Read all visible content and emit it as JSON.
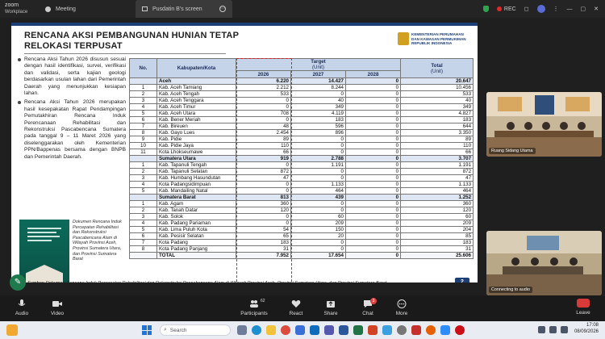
{
  "app": {
    "name_line1": "zoom",
    "name_line2": "Workplace",
    "meeting_tab": "Meeting",
    "share_tab": "Pusdatin B's screen",
    "rec_label": "REC"
  },
  "slide": {
    "title_line1": "RENCANA AKSI PEMBANGUNAN HUNIAN TETAP",
    "title_line2": "RELOKASI TERPUSAT",
    "ministry_name": "KEMENTERIAN PERUMAHAN DAN KAWASAN PERMUKIMAN REPUBLIK INDONESIA",
    "bullets": [
      "Rencana Aksi Tahun 2026 disusun sesuai dengan hasil identifikasi, survei, verifikasi dan validasi, serta kajian geologi berdasarkan usulan lahan dari Pemerintah Daerah yang menunjukkan kesiapan lahan.",
      "Rencana Aksi Tahun 2026 merupakan hasil kesepakatan Rapat Pendampingan Pemutakhiran Rencana Induk Perencanaan Rehabilitasi dan Rekonstruksi Pascabencana Sumatera pada tanggal 9 – 11 Maret 2026 yang diselenggarakan oleh Kementerian PPN/Bappenas bersama dengan BNPB dan Pemerintah Daerah."
    ],
    "doc_caption": "Dokumen Rencana Induk Percepatan Rehabilitasi dan Rekonstruksi Pascabencana Alam di Wilayah Provinsi Aceh, Provinsi Sumatera Utara, dan Provinsi Sumatera Barat",
    "source": "Sumber: Dokumen Rencana Induk Percepatan Rehabilitasi dan Rekonstruksi Pascabencana Alam di Wilayah Provinsi Aceh, Provinsi Sumatera Utara, dan Provinsi Sumatera Barat",
    "page": "2",
    "table": {
      "headers": {
        "no": "No.",
        "kab": "Kabupaten/Kota",
        "target": "Target",
        "target_unit": "(Unit)",
        "y2026": "2026",
        "y2027": "2027",
        "y2028": "2028",
        "total": "Total",
        "total_unit": "(Unit)"
      },
      "rows": [
        {
          "type": "group",
          "no": "",
          "name": "Aceh",
          "y2026": "6.220",
          "y2027": "14.427",
          "y2028": "0",
          "total": "20.647"
        },
        {
          "type": "row",
          "no": "1",
          "name": "Kab. Aceh Tamiang",
          "y2026": "2.212",
          "y2027": "8.244",
          "y2028": "0",
          "total": "10.456"
        },
        {
          "type": "row",
          "no": "2",
          "name": "Kab. Aceh Tengah",
          "y2026": "533",
          "y2027": "0",
          "y2028": "0",
          "total": "533"
        },
        {
          "type": "row",
          "no": "3",
          "name": "Kab. Aceh Tenggara",
          "y2026": "0",
          "y2027": "40",
          "y2028": "0",
          "total": "40"
        },
        {
          "type": "row",
          "no": "4",
          "name": "Kab. Aceh Timur",
          "y2026": "0",
          "y2027": "349",
          "y2028": "0",
          "total": "349"
        },
        {
          "type": "row",
          "no": "5",
          "name": "Kab. Aceh Utara",
          "y2026": "708",
          "y2027": "4.119",
          "y2028": "0",
          "total": "4.827"
        },
        {
          "type": "row",
          "no": "6",
          "name": "Kab. Bener Meriah",
          "y2026": "0",
          "y2027": "183",
          "y2028": "0",
          "total": "183"
        },
        {
          "type": "row",
          "no": "7",
          "name": "Kab. Bireuen",
          "y2026": "48",
          "y2027": "596",
          "y2028": "0",
          "total": "644"
        },
        {
          "type": "row",
          "no": "8",
          "name": "Kab. Gayo Lues",
          "y2026": "2.454",
          "y2027": "896",
          "y2028": "0",
          "total": "3.350"
        },
        {
          "type": "row",
          "no": "9",
          "name": "Kab. Pidie",
          "y2026": "89",
          "y2027": "0",
          "y2028": "0",
          "total": "89"
        },
        {
          "type": "row",
          "no": "10",
          "name": "Kab. Pidie Jaya",
          "y2026": "110",
          "y2027": "0",
          "y2028": "0",
          "total": "110"
        },
        {
          "type": "row",
          "no": "11",
          "name": "Kota Lhokseumawe",
          "y2026": "66",
          "y2027": "0",
          "y2028": "0",
          "total": "66"
        },
        {
          "type": "group",
          "no": "",
          "name": "Sumatera Utara",
          "y2026": "919",
          "y2027": "2.788",
          "y2028": "0",
          "total": "3.707"
        },
        {
          "type": "row",
          "no": "1",
          "name": "Kab. Tapanuli Tengah",
          "y2026": "0",
          "y2027": "1.191",
          "y2028": "0",
          "total": "1.191"
        },
        {
          "type": "row",
          "no": "2",
          "name": "Kab. Tapanuli Selatan",
          "y2026": "872",
          "y2027": "0",
          "y2028": "0",
          "total": "872"
        },
        {
          "type": "row",
          "no": "3",
          "name": "Kab. Humbang Hasundutan",
          "y2026": "47",
          "y2027": "0",
          "y2028": "0",
          "total": "47"
        },
        {
          "type": "row",
          "no": "4",
          "name": "Kota Padangsidimpuan",
          "y2026": "0",
          "y2027": "1.133",
          "y2028": "0",
          "total": "1.133"
        },
        {
          "type": "row",
          "no": "5",
          "name": "Kab. Mandailing Natal",
          "y2026": "0",
          "y2027": "464",
          "y2028": "0",
          "total": "464"
        },
        {
          "type": "group",
          "no": "",
          "name": "Sumatera Barat",
          "y2026": "813",
          "y2027": "439",
          "y2028": "0",
          "total": "1.252"
        },
        {
          "type": "row",
          "no": "1",
          "name": "Kab. Agam",
          "y2026": "360",
          "y2027": "0",
          "y2028": "0",
          "total": "360"
        },
        {
          "type": "row",
          "no": "2",
          "name": "Kab. Tanah Datar",
          "y2026": "120",
          "y2027": "0",
          "y2028": "0",
          "total": "120"
        },
        {
          "type": "row",
          "no": "3",
          "name": "Kab. Solok",
          "y2026": "0",
          "y2027": "60",
          "y2028": "0",
          "total": "60"
        },
        {
          "type": "row",
          "no": "4",
          "name": "Kab. Padang Pariaman",
          "y2026": "0",
          "y2027": "209",
          "y2028": "0",
          "total": "209"
        },
        {
          "type": "row",
          "no": "5",
          "name": "Kab. Lima Puluh Kota",
          "y2026": "54",
          "y2027": "150",
          "y2028": "0",
          "total": "204"
        },
        {
          "type": "row",
          "no": "6",
          "name": "Kab. Pesisir Selatan",
          "y2026": "65",
          "y2027": "20",
          "y2028": "0",
          "total": "85"
        },
        {
          "type": "row",
          "no": "7",
          "name": "Kota Padang",
          "y2026": "183",
          "y2027": "0",
          "y2028": "0",
          "total": "183"
        },
        {
          "type": "row",
          "no": "8",
          "name": "Kota Padang Panjang",
          "y2026": "31",
          "y2027": "0",
          "y2028": "0",
          "total": "31"
        },
        {
          "type": "total",
          "no": "",
          "name": "TOTAL",
          "y2026": "7.952",
          "y2027": "17.654",
          "y2028": "0",
          "total": "25.606"
        }
      ]
    }
  },
  "participants": {
    "tile1_label": "Ruang Sidang Utama",
    "tile2_label": "Connecting to audio"
  },
  "toolbar": {
    "audio": "Audio",
    "video": "Video",
    "participants": "Participants",
    "participants_count": "62",
    "react": "React",
    "share": "Share",
    "chat": "Chat",
    "chat_badge": "3",
    "more": "More",
    "leave": "Leave"
  },
  "taskbar": {
    "search_placeholder": "Search",
    "time": "17:08",
    "date": "08/09/2026"
  },
  "colors": {
    "accent_blue": "#1c3f78",
    "highlight_red": "#dd2222",
    "header_blue": "#c6d4ea"
  }
}
